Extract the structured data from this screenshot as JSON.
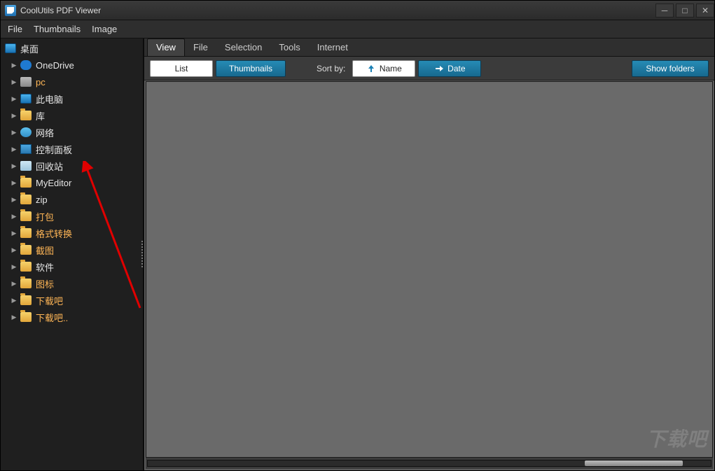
{
  "title": "CoolUtils PDF Viewer",
  "menubar": [
    "File",
    "Thumbnails",
    "Image"
  ],
  "tree": {
    "root": {
      "label": "桌面",
      "iconClass": "monitor-icon"
    },
    "items": [
      {
        "label": "OneDrive",
        "iconClass": "cloud-icon",
        "orange": false
      },
      {
        "label": "pc",
        "iconClass": "pc-icon",
        "orange": true
      },
      {
        "label": "此电脑",
        "iconClass": "monitor-icon",
        "orange": false
      },
      {
        "label": "库",
        "iconClass": "folder-icon",
        "orange": false
      },
      {
        "label": "网络",
        "iconClass": "net-icon",
        "orange": false
      },
      {
        "label": "控制面板",
        "iconClass": "panel-icon",
        "orange": false
      },
      {
        "label": "回收站",
        "iconClass": "bin-icon",
        "orange": false
      },
      {
        "label": "MyEditor",
        "iconClass": "folder-icon",
        "orange": false
      },
      {
        "label": "zip",
        "iconClass": "folder-icon",
        "orange": false
      },
      {
        "label": "打包",
        "iconClass": "folder-icon",
        "orange": true
      },
      {
        "label": "格式转换",
        "iconClass": "folder-icon",
        "orange": true
      },
      {
        "label": "截图",
        "iconClass": "folder-icon",
        "orange": true
      },
      {
        "label": "软件",
        "iconClass": "folder-icon",
        "orange": false
      },
      {
        "label": "图标",
        "iconClass": "folder-icon",
        "orange": true
      },
      {
        "label": "下载吧",
        "iconClass": "folder-icon",
        "orange": true
      },
      {
        "label": "下载吧..",
        "iconClass": "folder-icon",
        "orange": true
      }
    ]
  },
  "tabs": {
    "items": [
      "View",
      "File",
      "Selection",
      "Tools",
      "Internet"
    ],
    "activeIndex": 0
  },
  "toolbar": {
    "list": "List",
    "thumbnails": "Thumbnails",
    "sortby": "Sort by:",
    "name": "Name",
    "date": "Date",
    "showfolders": "Show folders"
  },
  "watermark": "下载吧"
}
